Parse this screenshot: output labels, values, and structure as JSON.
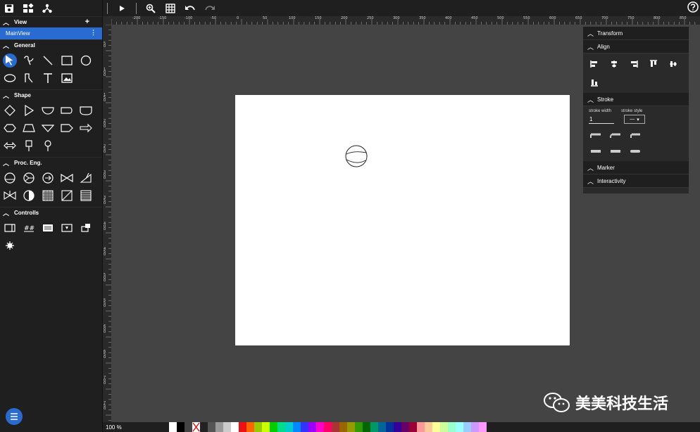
{
  "sidebar": {
    "view_section": "View",
    "mainview_label": "MainView",
    "sections": {
      "general": "General",
      "shape": "Shape",
      "proc": "Proc. Eng.",
      "controls": "Controlls"
    }
  },
  "ruler": {
    "h_labels": [
      "-200",
      "-150",
      "-100",
      "-50",
      "0",
      "50",
      "100",
      "150",
      "200",
      "250",
      "300",
      "350",
      "400",
      "450",
      "500",
      "550",
      "600",
      "650",
      "700",
      "750",
      "800",
      "850"
    ],
    "v_labels": [
      "50",
      "100",
      "150",
      "200",
      "250",
      "300",
      "350",
      "400",
      "450",
      "500",
      "550",
      "600",
      "650",
      "700",
      "750",
      "800"
    ]
  },
  "panel": {
    "transform": "Transform",
    "align": "Align",
    "stroke": "Stroke",
    "stroke_width_label": "stroke width",
    "stroke_style_label": "stroke style",
    "stroke_width_value": "1",
    "stroke_style_value": "—",
    "marker": "Marker",
    "interactivity": "Interactivity"
  },
  "status": {
    "zoom": "100 %"
  },
  "palette": [
    "#ffffff",
    "#000000",
    "#444444",
    "#ff0000",
    "#222222",
    "#555555",
    "#999999",
    "#cccccc",
    "#ffffff",
    "#ee1111",
    "#ff6600",
    "#99cc00",
    "#ccff00",
    "#00cc00",
    "#00dd88",
    "#00cccc",
    "#0088ff",
    "#3333ff",
    "#9900ff",
    "#ff00cc",
    "#ff0066",
    "#aa3333",
    "#996600",
    "#999900",
    "#339900",
    "#006600",
    "#009966",
    "#006699",
    "#003399",
    "#330099",
    "#660066",
    "#990033",
    "#ff9999",
    "#ffcc99",
    "#ffff99",
    "#ccff99",
    "#99ffcc",
    "#99ffff",
    "#99ccff",
    "#cc99ff",
    "#ff99ff"
  ],
  "watermark": "美美科技生活"
}
